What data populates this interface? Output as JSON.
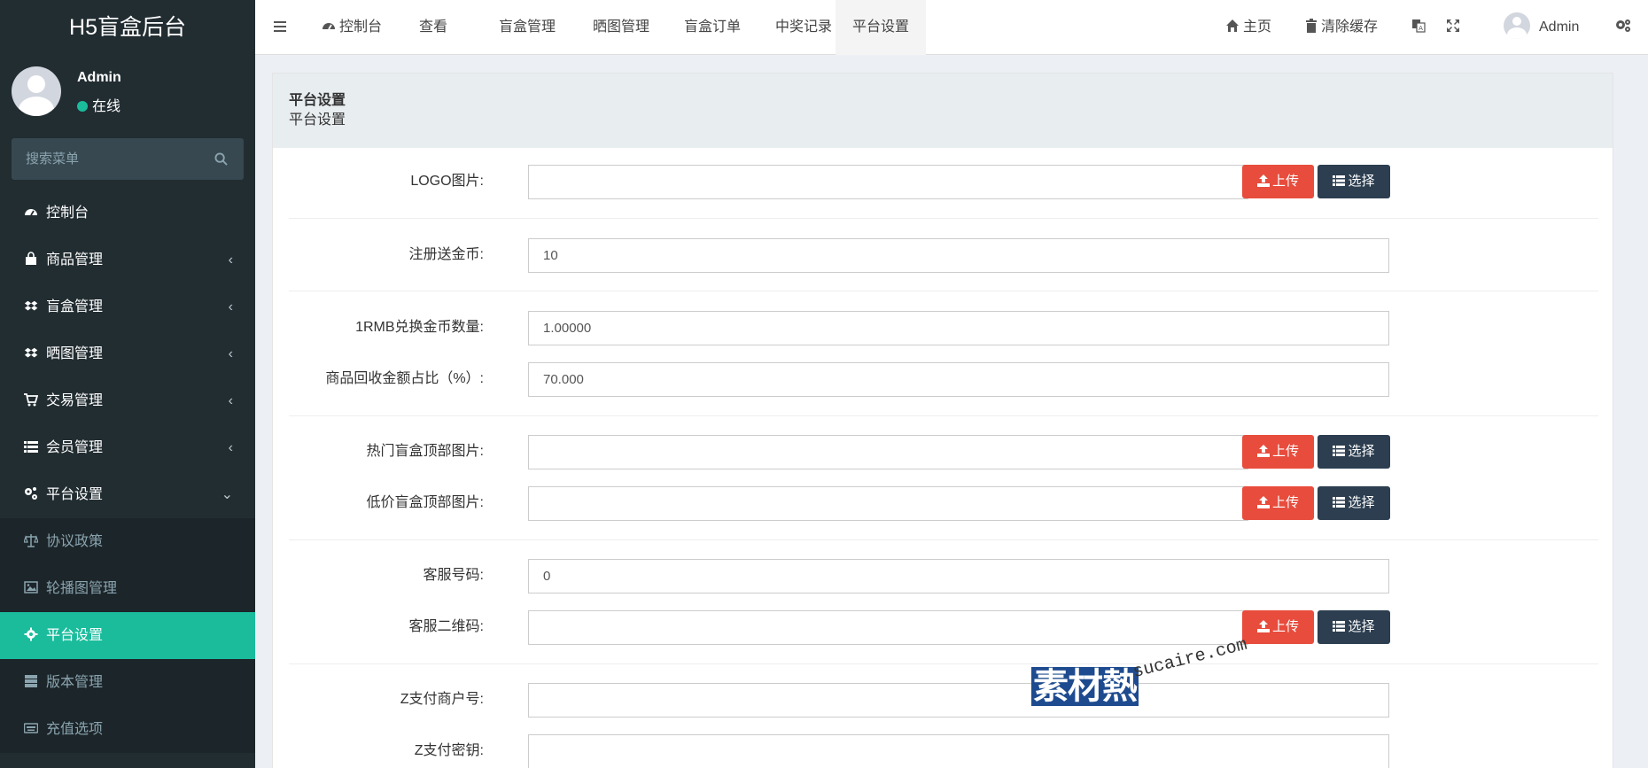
{
  "app": {
    "title": "H5盲盒后台"
  },
  "user": {
    "name": "Admin",
    "status": "在线"
  },
  "search": {
    "placeholder": "搜索菜单"
  },
  "sidebar": {
    "items": [
      {
        "label": "控制台",
        "icon": "dashboard-icon"
      },
      {
        "label": "商品管理",
        "icon": "shopping-bag-icon"
      },
      {
        "label": "盲盒管理",
        "icon": "dropbox-icon"
      },
      {
        "label": "晒图管理",
        "icon": "dropbox-icon"
      },
      {
        "label": "交易管理",
        "icon": "cart-icon"
      },
      {
        "label": "会员管理",
        "icon": "list-icon"
      },
      {
        "label": "平台设置",
        "icon": "gears-icon"
      }
    ],
    "subitems": [
      {
        "label": "协议政策",
        "icon": "balance-scale-icon"
      },
      {
        "label": "轮播图管理",
        "icon": "image-icon"
      },
      {
        "label": "平台设置",
        "icon": "gear-icon"
      },
      {
        "label": "版本管理",
        "icon": "server-icon"
      },
      {
        "label": "充值选项",
        "icon": "keyboard-icon"
      }
    ]
  },
  "topnav": {
    "tabs": [
      "控制台",
      "查看",
      "盲盒管理",
      "晒图管理",
      "盲盒订单",
      "中奖记录",
      "平台设置"
    ],
    "home": "主页",
    "clear_cache": "清除缓存",
    "admin": "Admin"
  },
  "page": {
    "title": "平台设置",
    "subtitle": "平台设置"
  },
  "form": {
    "upload_label": "上传",
    "select_label": "选择",
    "fields": {
      "logo": {
        "label": "LOGO图片:",
        "value": ""
      },
      "register_coin": {
        "label": "注册送金币:",
        "value": "10"
      },
      "rmb_rate": {
        "label": "1RMB兑换金币数量:",
        "value": "1.00000"
      },
      "recycle_ratio": {
        "label": "商品回收金额占比（%）:",
        "value": "70.000"
      },
      "hot_top_img": {
        "label": "热门盲盒顶部图片:",
        "value": ""
      },
      "cheap_top_img": {
        "label": "低价盲盒顶部图片:",
        "value": ""
      },
      "service_phone": {
        "label": "客服号码:",
        "value": "0"
      },
      "service_qr": {
        "label": "客服二维码:",
        "value": ""
      },
      "z_merchant": {
        "label": "Z支付商户号:",
        "value": ""
      },
      "z_secret": {
        "label": "Z支付密钥:",
        "value": ""
      }
    }
  },
  "watermark": {
    "cn": "素材熱",
    "en": "sucaire.com"
  },
  "colors": {
    "sidebar_bg": "#222d32",
    "accent": "#1abc9c",
    "upload": "#e74c3c",
    "select": "#2c3e50"
  }
}
